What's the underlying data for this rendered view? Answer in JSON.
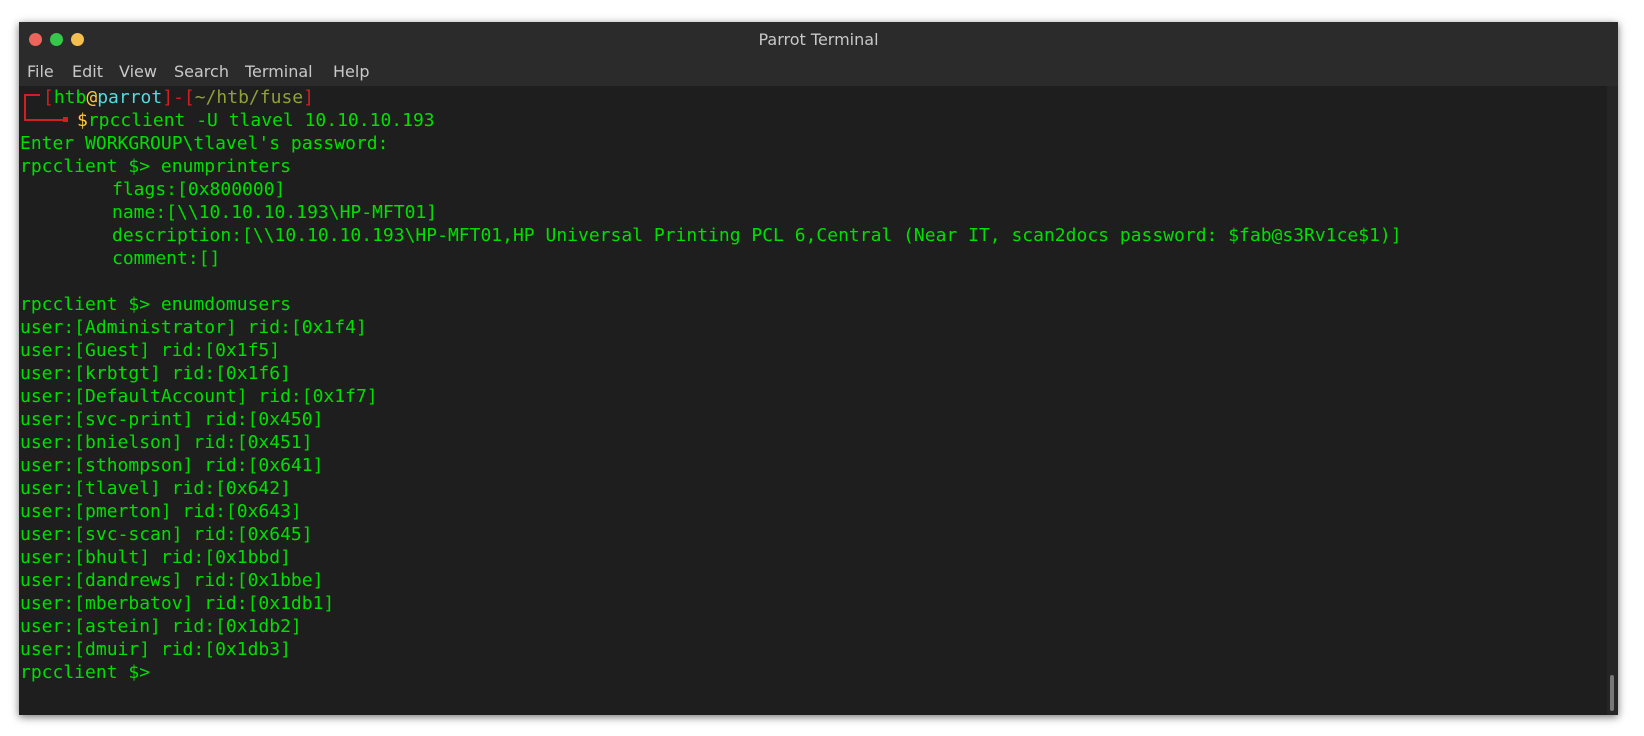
{
  "window": {
    "title": "Parrot Terminal"
  },
  "menu": [
    "File",
    "Edit",
    "View",
    "Search",
    "Terminal",
    "Help"
  ],
  "prompt": {
    "open": "[",
    "user": "htb",
    "at": "@",
    "host": "parrot",
    "close_sep": "]-[",
    "path": "~/htb/fuse",
    "end": "]",
    "dollar": "$",
    "command": "rpcclient -U tlavel 10.10.10.193"
  },
  "output": {
    "password_prompt": "Enter WORKGROUP\\tlavel's password:",
    "cmd1": "rpcclient $> enumprinters",
    "printer": {
      "flags": "flags:[0x800000]",
      "name": "name:[\\\\10.10.10.193\\HP-MFT01]",
      "description": "description:[\\\\10.10.10.193\\HP-MFT01,HP Universal Printing PCL 6,Central (Near IT, scan2docs password: $fab@s3Rv1ce$1)]",
      "comment": "comment:[]"
    },
    "cmd2": "rpcclient $> enumdomusers",
    "users": [
      "user:[Administrator] rid:[0x1f4]",
      "user:[Guest] rid:[0x1f5]",
      "user:[krbtgt] rid:[0x1f6]",
      "user:[DefaultAccount] rid:[0x1f7]",
      "user:[svc-print] rid:[0x450]",
      "user:[bnielson] rid:[0x451]",
      "user:[sthompson] rid:[0x641]",
      "user:[tlavel] rid:[0x642]",
      "user:[pmerton] rid:[0x643]",
      "user:[svc-scan] rid:[0x645]",
      "user:[bhult] rid:[0x1bbd]",
      "user:[dandrews] rid:[0x1bbe]",
      "user:[mberbatov] rid:[0x1db1]",
      "user:[astein] rid:[0x1db2]",
      "user:[dmuir] rid:[0x1db3]"
    ],
    "final_prompt": "rpcclient $>"
  },
  "colors": {
    "terminal_bg": "#1e1e1e",
    "text_green": "#00e000",
    "prompt_red": "#d02020",
    "prompt_yellow": "#ffcc33",
    "prompt_cyan": "#56d9e0",
    "path_olive": "#8fa036"
  }
}
